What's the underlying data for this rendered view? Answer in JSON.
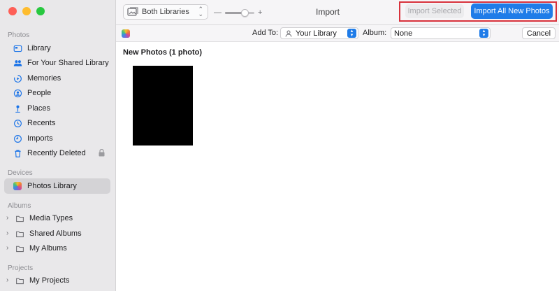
{
  "sidebar": {
    "sections": {
      "photos": "Photos",
      "devices": "Devices",
      "albums": "Albums",
      "projects": "Projects"
    },
    "photos_items": [
      {
        "label": "Library",
        "icon": "library-icon"
      },
      {
        "label": "For Your Shared Library",
        "icon": "shared-people-icon"
      },
      {
        "label": "Memories",
        "icon": "memories-icon"
      },
      {
        "label": "People",
        "icon": "people-icon"
      },
      {
        "label": "Places",
        "icon": "places-pin-icon"
      },
      {
        "label": "Recents",
        "icon": "recents-clock-icon"
      },
      {
        "label": "Imports",
        "icon": "imports-clock-icon"
      },
      {
        "label": "Recently Deleted",
        "icon": "trash-icon"
      }
    ],
    "device_items": [
      {
        "label": "Photos Library",
        "icon": "photos-app-icon",
        "selected": true
      }
    ],
    "album_items": [
      {
        "label": "Media Types",
        "icon": "folder-icon"
      },
      {
        "label": "Shared Albums",
        "icon": "folder-icon"
      },
      {
        "label": "My Albums",
        "icon": "folder-icon"
      }
    ],
    "project_items": [
      {
        "label": "My Projects",
        "icon": "folder-icon"
      }
    ]
  },
  "toolbar": {
    "library_filter": "Both Libraries",
    "zoom_minus": "—",
    "zoom_plus": "+",
    "zoom_level": 0.75,
    "title": "Import",
    "import_selected_label": "Import Selected",
    "import_all_label": "Import All New Photos"
  },
  "subbar": {
    "add_to_label": "Add To:",
    "add_to_value": "Your Library",
    "album_label": "Album:",
    "album_value": "None",
    "cancel_label": "Cancel"
  },
  "main": {
    "section_heading": "New Photos (1 photo)"
  },
  "colors": {
    "accent": "#1f7ce8",
    "highlight": "#d8323c",
    "sidebar_bg": "#e9e8ea"
  }
}
